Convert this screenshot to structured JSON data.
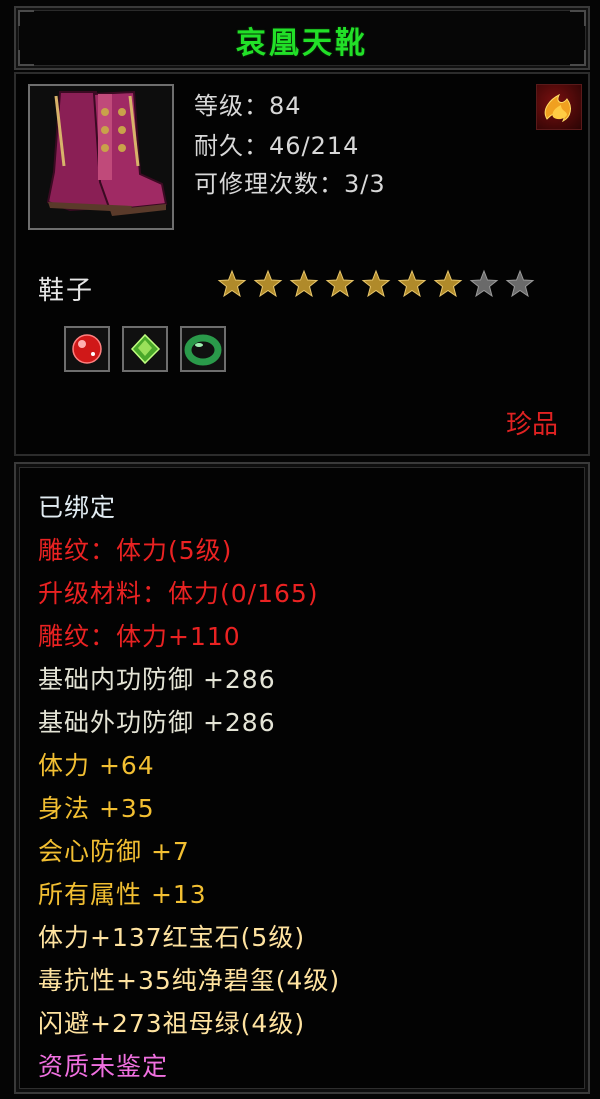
{
  "item": {
    "name": "哀凰天靴",
    "image_icon": "boots-icon",
    "set_icon": "fire-emblem-icon",
    "level_line": "等级：84",
    "durability_line": "耐久：46/214",
    "repair_line": "可修理次数：3/3",
    "type": "鞋子",
    "stars": {
      "filled": 7,
      "total": 9
    },
    "gems": [
      "ruby-gem-icon",
      "green-gem-icon",
      "jade-ring-icon"
    ],
    "rarity": "珍品"
  },
  "attributes": [
    {
      "text": "已绑定",
      "color": "white"
    },
    {
      "text": "雕纹：体力(5级)",
      "color": "red"
    },
    {
      "text": "升级材料：体力(0/165)",
      "color": "red"
    },
    {
      "text": "雕纹：体力+110",
      "color": "red"
    },
    {
      "text": "基础内功防御 +286",
      "color": "light"
    },
    {
      "text": "基础外功防御 +286",
      "color": "light"
    },
    {
      "text": "体力 +64",
      "color": "gold"
    },
    {
      "text": "身法 +35",
      "color": "gold"
    },
    {
      "text": "会心防御 +7",
      "color": "gold"
    },
    {
      "text": "所有属性 +13",
      "color": "gold"
    },
    {
      "text": "体力+137红宝石(5级)",
      "color": "gem"
    },
    {
      "text": "毒抗性+35纯净碧玺(4级)",
      "color": "gem"
    },
    {
      "text": "闪避+273祖母绿(4级)",
      "color": "gem"
    },
    {
      "text": "资质未鉴定",
      "color": "pink"
    }
  ],
  "colors": {
    "title": "#22e028",
    "rarity": "#e02222",
    "star_filled": "#b08a2a",
    "star_empty": "#6a6a6a"
  }
}
